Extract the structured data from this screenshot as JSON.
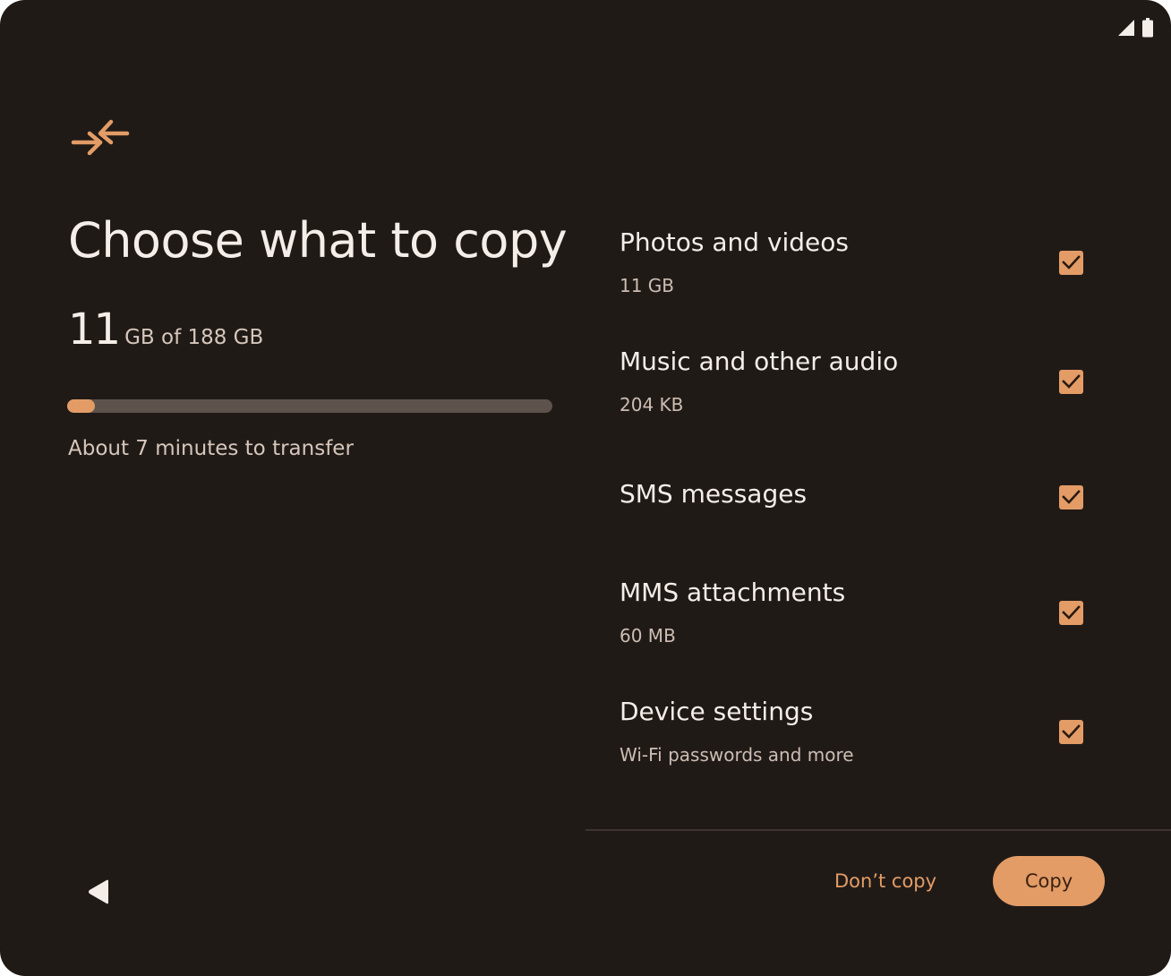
{
  "status_bar": {
    "icons": [
      "signal-icon",
      "battery-icon"
    ]
  },
  "header": {
    "icon": "transfer-arrows-icon",
    "title": "Choose what to copy"
  },
  "summary": {
    "selected_amount": "11",
    "selected_detail": "GB of 188 GB",
    "progress_fraction": 0.058,
    "eta_text": "About 7 minutes to transfer"
  },
  "items": [
    {
      "title": "Photos and videos",
      "subtitle": "11 GB",
      "checked": true
    },
    {
      "title": "Music and other audio",
      "subtitle": "204 KB",
      "checked": true
    },
    {
      "title": "SMS messages",
      "subtitle": "",
      "checked": true
    },
    {
      "title": "MMS attachments",
      "subtitle": "60 MB",
      "checked": true
    },
    {
      "title": "Device settings",
      "subtitle": "Wi-Fi passwords and more",
      "checked": true
    }
  ],
  "footer": {
    "secondary_label": "Don’t copy",
    "primary_label": "Copy"
  },
  "nav": {
    "back_icon": "back-triangle-icon"
  },
  "colors": {
    "background": "#201a17",
    "accent": "#e39c66",
    "track": "#5e534c"
  }
}
